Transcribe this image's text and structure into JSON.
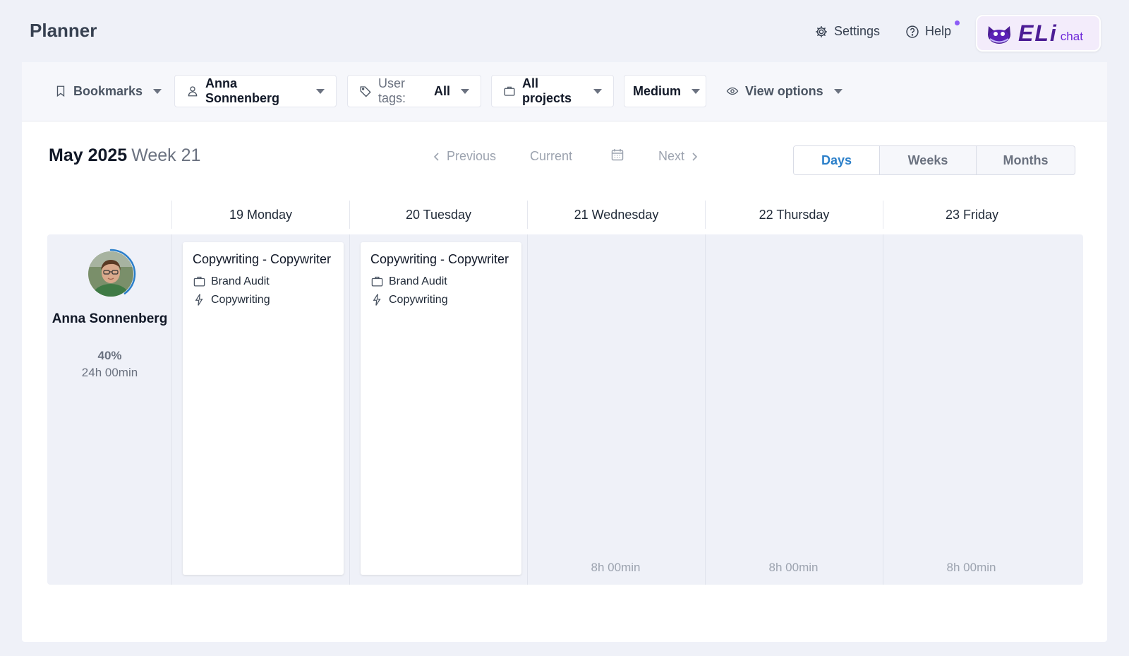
{
  "header": {
    "title": "Planner",
    "settings_label": "Settings",
    "help_label": "Help",
    "eli_label": "ELi",
    "eli_chat_label": "chat"
  },
  "filters": {
    "bookmarks": "Bookmarks",
    "user": "Anna Sonnenberg",
    "tags_prefix": "User tags:",
    "tags_value": "All",
    "projects": "All projects",
    "density": "Medium",
    "view_options": "View options"
  },
  "period": {
    "month": "May 2025",
    "week": "Week 21"
  },
  "nav": {
    "previous": "Previous",
    "current": "Current",
    "next": "Next"
  },
  "scale": {
    "days": "Days",
    "weeks": "Weeks",
    "months": "Months",
    "active": "Days"
  },
  "days": [
    {
      "date": "19 Monday"
    },
    {
      "date": "20 Tuesday"
    },
    {
      "date": "21 Wednesday",
      "free": "8h 00min"
    },
    {
      "date": "22 Thursday",
      "free": "8h 00min"
    },
    {
      "date": "23 Friday",
      "free": "8h 00min"
    }
  ],
  "user": {
    "name": "Anna Sonnenberg",
    "utilization": "40%",
    "utilization_value": 0.4,
    "hours": "24h 00min"
  },
  "tasks": [
    {
      "title": "Copywriting - Copywriter",
      "project": "Brand Audit",
      "activity": "Copywriting"
    },
    {
      "title": "Copywriting - Copywriter",
      "project": "Brand Audit",
      "activity": "Copywriting"
    }
  ],
  "colors": {
    "accent": "#2b7fc9",
    "help_dot": "#8b5cf6",
    "eli_purple": "#4c1d95"
  }
}
